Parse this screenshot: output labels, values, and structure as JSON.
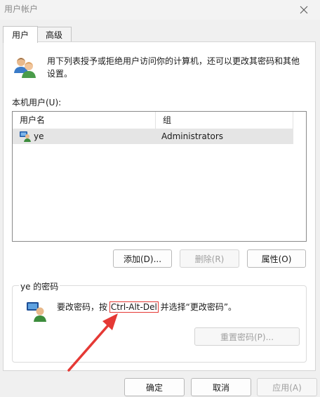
{
  "window": {
    "title": "用户帐户"
  },
  "tabs": [
    {
      "label": "用户"
    },
    {
      "label": "高级"
    }
  ],
  "intro": {
    "text": "用下列表授予或拒绝用户访问你的计算机，还可以更改其密码和其他设置。"
  },
  "local_users": {
    "label": "本机用户(U):",
    "columns": [
      "用户名",
      "组"
    ],
    "rows": [
      {
        "name": "ye",
        "group": "Administrators"
      }
    ]
  },
  "list_buttons": {
    "add": "添加(D)...",
    "remove": "删除(R)",
    "properties": "属性(O)"
  },
  "password_group": {
    "title": "ye 的密码",
    "text_before": "要改密码，按 ",
    "text_keys": "Ctrl-Alt-Del",
    "text_after": " 并选择“更改密码”。",
    "reset_button": "重置密码(P)..."
  },
  "dialog_buttons": {
    "ok": "确定",
    "cancel": "取消",
    "apply": "应用(A)"
  },
  "colors": {
    "annotation": "#e53935",
    "selection": "#e5e5e5"
  },
  "icons": {
    "users": "users-icon",
    "user_row": "user-row-icon",
    "password": "user-key-icon",
    "close": "close-icon"
  }
}
